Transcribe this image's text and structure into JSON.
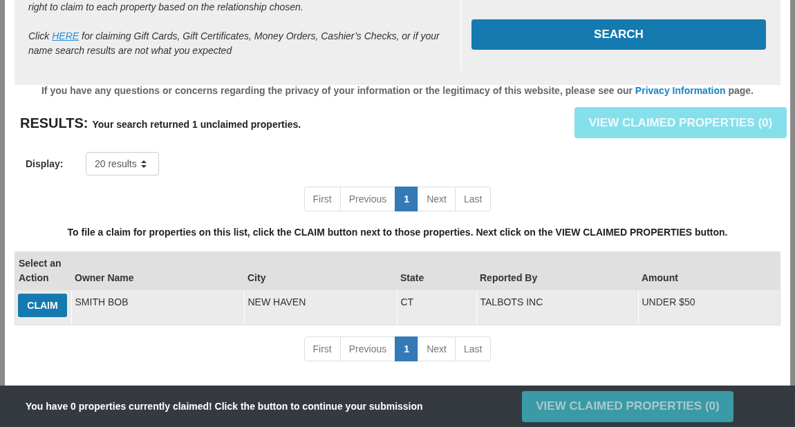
{
  "intro": {
    "lines": [
      "right to claim to each property based on the relationship chosen."
    ],
    "here_before": "Click ",
    "here_link": "HERE",
    "here_after": " for claiming Gift Cards, Gift Certificates, Money Orders, Cashier’s Checks, or if your name search results are not what you expected"
  },
  "search_button": "SEARCH",
  "privacy": {
    "before": "If you have any questions or concerns regarding the privacy of your information or the legitimacy of this website, please see our ",
    "link": "Privacy Information",
    "after": " page."
  },
  "results": {
    "title": "RESULTS:",
    "summary": "Your search returned 1 unclaimed properties.",
    "view_button": "VIEW CLAIMED PROPERTIES (0)",
    "view_disabled": true
  },
  "display": {
    "label": "Display:",
    "value": "20 results"
  },
  "pagination_top": [
    {
      "label": "First",
      "selected": false
    },
    {
      "label": "Previous",
      "selected": false
    },
    {
      "label": "1",
      "selected": true
    },
    {
      "label": "Next",
      "selected": false
    },
    {
      "label": "Last",
      "selected": false
    }
  ],
  "instruction": "To file a claim for properties on this list, click the CLAIM button next to those properties. Next click on the VIEW CLAIMED PROPERTIES button.",
  "table": {
    "columns": [
      "Select an Action",
      "Owner Name",
      "City",
      "State",
      "Reported By",
      "Amount"
    ],
    "rows": [
      {
        "cells": [
          {
            "kind": "button",
            "text": "CLAIM"
          },
          {
            "kind": "text",
            "text": "SMITH BOB"
          },
          {
            "kind": "text",
            "text": "NEW HAVEN"
          },
          {
            "kind": "text",
            "text": "CT"
          },
          {
            "kind": "text",
            "text": "TALBOTS INC"
          },
          {
            "kind": "text",
            "text": "UNDER $50"
          }
        ]
      }
    ]
  },
  "pagination_bottom": [
    {
      "label": "First",
      "selected": false
    },
    {
      "label": "Previous",
      "selected": false
    },
    {
      "label": "1",
      "selected": true
    },
    {
      "label": "Next",
      "selected": false
    },
    {
      "label": "Last",
      "selected": false
    }
  ],
  "footer": {
    "message": "You have 0 properties currently claimed! Click the button to continue your submission",
    "button": "VIEW CLAIMED PROPERTIES (0)",
    "button_disabled": true
  }
}
